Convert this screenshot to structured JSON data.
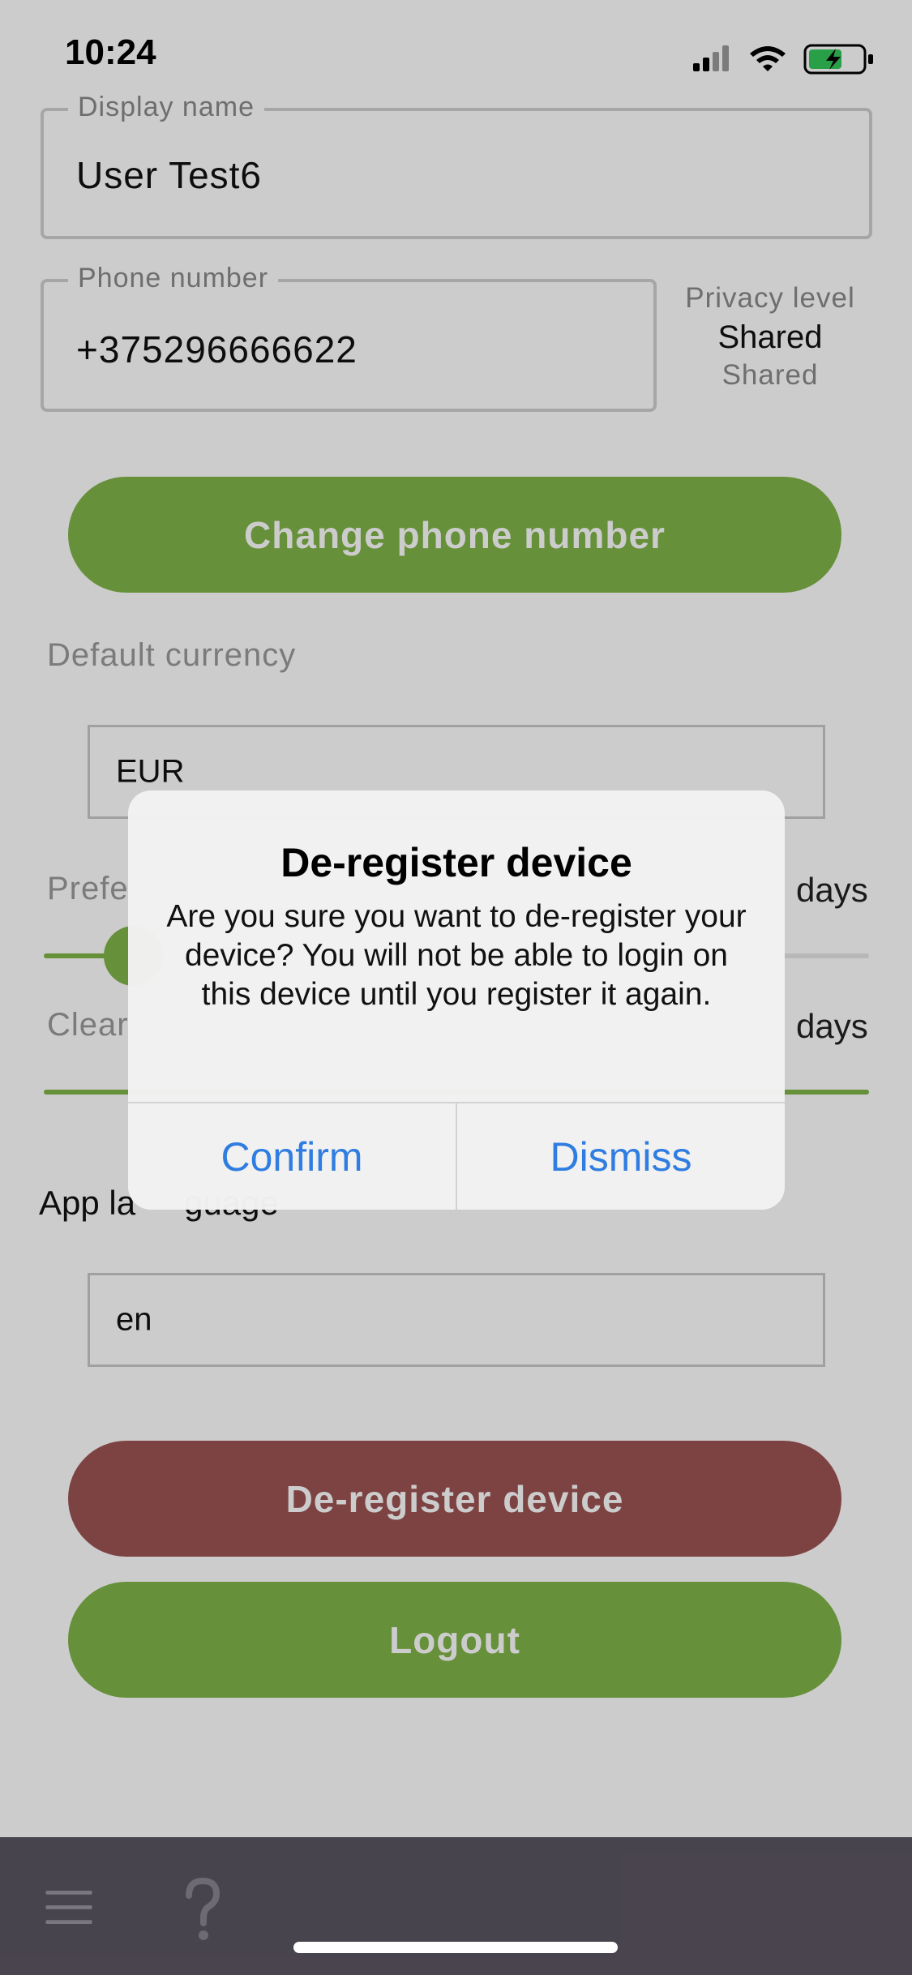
{
  "status_bar": {
    "time": "10:24"
  },
  "profile": {
    "display_name": {
      "label": "Display name",
      "value": "User Test6"
    },
    "phone_number": {
      "label": "Phone number",
      "value": "+375296666622"
    },
    "privacy": {
      "label": "Privacy level",
      "value": "Shared",
      "sub": "Shared"
    }
  },
  "buttons": {
    "change_phone": "Change phone number",
    "deregister": "De-register device",
    "logout": "Logout"
  },
  "default_currency": {
    "label": "Default currency",
    "value": "EUR"
  },
  "preferred": {
    "label_partial": "Prefe",
    "unit": "days",
    "slider_fraction": 0.1
  },
  "clear": {
    "label_partial": "Clear",
    "unit": "days",
    "slider_fraction": 1.0
  },
  "app_language": {
    "label_partial": "App la",
    "label_tail": "guage",
    "value": "en"
  },
  "dialog": {
    "title": "De-register device",
    "message": "Are you sure you want to de-register your device? You will not be able to login on this device until you register it again.",
    "confirm": "Confirm",
    "dismiss": "Dismiss"
  },
  "bottom_nav": {
    "menu_icon": "hamburger-menu-icon",
    "help_icon": "question-mark-icon"
  },
  "colors": {
    "green": "#80b548",
    "red": "#9d5353",
    "link_blue": "#2f7de1",
    "bottom_bar": "#5b5562"
  }
}
